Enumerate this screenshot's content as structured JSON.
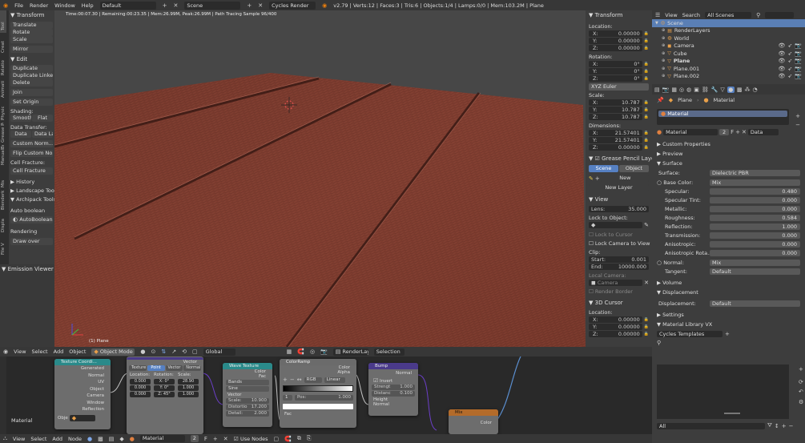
{
  "topbar": {
    "menu": [
      "File",
      "Render",
      "Window",
      "Help"
    ],
    "layout": "Default",
    "scene": "Scene",
    "engine": "Cycles Render",
    "stats": "v2.79 | Verts:12 | Faces:3 | Tris:6 | Objects:1/4 | Lamps:0/0 | Mem:103.2M | Plane"
  },
  "viewport": {
    "render_info": "Time:00:07.30 | Remaining:00:23.35 | Mem:26.99M, Peak:26.99M | Path Tracing Sample 96/400",
    "object_label": "(1) Plane",
    "colors": {
      "bg": "#474747",
      "wood": "#7a3a2c"
    }
  },
  "toolshelf": {
    "tabs": [
      "Tool",
      "Creat",
      "Relatio",
      "Animati",
      "Physic",
      "Grease Pen",
      "ManualBootstrapL",
      "Mis",
      "Blenderk",
      "Displa",
      "File V"
    ],
    "transform_header": "Transform",
    "translate": "Translate",
    "rotate": "Rotate",
    "scale": "Scale",
    "mirror": "Mirror",
    "edit_header": "Edit",
    "duplicate": "Duplicate",
    "duplicate_linked": "Duplicate Linked",
    "delete": "Delete",
    "join": "Join",
    "set_origin": "Set Origin",
    "shading_label": "Shading:",
    "smooth": "Smooth",
    "flat": "Flat",
    "data_transfer_label": "Data Transfer:",
    "data": "Data",
    "data_la": "Data La",
    "custom_norm": "Custom Norm...",
    "flip_custom": "Flip Custom No...",
    "cell_fracture_label": "Cell Fracture:",
    "cell_fracture": "Cell Fracture",
    "history": "History",
    "landscape": "Landscape Tool",
    "archipack": "Archipack Tools",
    "autoboolean_label": "Auto boolean",
    "autoboolean": "AutoBoolean",
    "rendering": "Rendering",
    "draw_over": "Draw over",
    "emission_viewer": "Emission Viewer"
  },
  "npanel": {
    "transform_header": "Transform",
    "location_label": "Location:",
    "location": [
      {
        "a": "X:",
        "v": "0.00000"
      },
      {
        "a": "Y:",
        "v": "0.00000"
      },
      {
        "a": "Z:",
        "v": "0.00000"
      }
    ],
    "rotation_label": "Rotation:",
    "rotation": [
      {
        "a": "X:",
        "v": "0°"
      },
      {
        "a": "Y:",
        "v": "0°"
      },
      {
        "a": "Z:",
        "v": "0°"
      }
    ],
    "euler": "XYZ Euler",
    "scale_label": "Scale:",
    "scale": [
      {
        "a": "X:",
        "v": "10.787"
      },
      {
        "a": "Y:",
        "v": "10.787"
      },
      {
        "a": "Z:",
        "v": "10.787"
      }
    ],
    "dimensions_label": "Dimensions:",
    "dimensions": [
      {
        "a": "X:",
        "v": "21.57401"
      },
      {
        "a": "Y:",
        "v": "21.57401"
      },
      {
        "a": "Z:",
        "v": "0.00000"
      }
    ],
    "grease_pencil": "Grease Pencil Laye",
    "scene_tab": "Scene",
    "object_tab": "Object",
    "new_btn": "New",
    "new_layer": "New Layer",
    "view_header": "View",
    "lens_label": "Lens:",
    "lens": "35.000",
    "lock_object": "Lock to Object:",
    "lock_cursor": "Lock to Cursor",
    "lock_camera": "Lock Camera to View",
    "clip_label": "Clip:",
    "clip_start_label": "Start:",
    "clip_start": "0.001",
    "clip_end_label": "End:",
    "clip_end": "10000.000",
    "local_camera": "Local Camera:",
    "camera": "Camera",
    "render_border": "Render Border",
    "cursor_header": "3D Cursor",
    "cursor_location": "Location:",
    "cursor": [
      {
        "a": "X:",
        "v": "0.00000"
      },
      {
        "a": "Y:",
        "v": "0.00000"
      },
      {
        "a": "Z:",
        "v": "0.00000"
      }
    ]
  },
  "outliner": {
    "view": "View",
    "search": "Search",
    "filter": "All Scenes",
    "items": [
      {
        "name": "Scene",
        "depth": 0,
        "icon": "scene-icon",
        "sel": true
      },
      {
        "name": "RenderLayers",
        "depth": 1,
        "icon": "render-layers-icon"
      },
      {
        "name": "World",
        "depth": 1,
        "icon": "world-icon"
      },
      {
        "name": "Camera",
        "depth": 1,
        "icon": "camera-icon",
        "vis": true
      },
      {
        "name": "Cube",
        "depth": 1,
        "icon": "mesh-icon",
        "vis": true
      },
      {
        "name": "Plane",
        "depth": 1,
        "icon": "mesh-icon",
        "vis": true,
        "bold": true
      },
      {
        "name": "Plane.001",
        "depth": 1,
        "icon": "mesh-icon",
        "vis": true
      },
      {
        "name": "Plane.002",
        "depth": 1,
        "icon": "mesh-icon",
        "vis": true
      }
    ]
  },
  "properties": {
    "breadcrumb_object": "Plane",
    "breadcrumb_material": "Material",
    "slot": "Material",
    "mat_name": "Material",
    "users": "2",
    "data": "Data",
    "sections": {
      "custom_props": "Custom Properties",
      "preview": "Preview",
      "surface": "Surface",
      "volume": "Volume",
      "displacement": "Displacement",
      "settings": "Settings",
      "matlib": "Material Library VX"
    },
    "surface_label": "Surface:",
    "surface_val": "Dielectric PBR",
    "base_color_label": "Base Color:",
    "base_color_val": "Mix",
    "rows": [
      {
        "l": "Specular:",
        "v": "0.480"
      },
      {
        "l": "Specular Tint:",
        "v": "0.000"
      },
      {
        "l": "Metallic:",
        "v": "0.000"
      },
      {
        "l": "Roughness:",
        "v": "0.584"
      },
      {
        "l": "Reflection:",
        "v": "1.000"
      },
      {
        "l": "Transmission:",
        "v": "0.000"
      },
      {
        "l": "Anisotropic:",
        "v": "0.000"
      },
      {
        "l": "Anisotropic Rota...",
        "v": "0.000"
      }
    ],
    "normal_label": "Normal:",
    "normal_val": "Mix",
    "tangent_label": "Tangent:",
    "tangent_val": "Default",
    "displacement_label": "Displacement:",
    "displacement_val": "Default",
    "templates": "Cycles Templates",
    "all": "All"
  },
  "view3d_header": {
    "menu": [
      "View",
      "Select",
      "Add",
      "Object"
    ],
    "mode": "Object Mode",
    "orientation": "Global",
    "renderlayer": "RenderLayer",
    "selection": "Selection"
  },
  "node_header": {
    "menu": [
      "View",
      "Select",
      "Add",
      "Node"
    ],
    "material": "Material",
    "users": "2",
    "use_nodes": "Use Nodes"
  },
  "nodes": {
    "tex_coord": {
      "title": "Texture Coordi...",
      "outputs": [
        "Generated",
        "Normal",
        "UV",
        "Object",
        "Camera",
        "Window",
        "Reflection"
      ],
      "obj_label": "Obje"
    },
    "mapping": {
      "title": "Mapping",
      "vector": "Vector",
      "tabs": [
        "Texture",
        "Point",
        "Vector",
        "Normal"
      ],
      "loc": "Location:",
      "rot": "Rotation:",
      "scl": "Scale:",
      "locv": [
        "0.000",
        "0.000",
        "0.000"
      ],
      "rotv": [
        "X: 0°",
        "Y: 0°",
        "Z: 45°"
      ],
      "sclv": [
        "28.90",
        "1.000",
        "1.000"
      ]
    },
    "wave": {
      "title": "Wave Texture",
      "color": "Color",
      "fac": "Fac",
      "bands": "Bands",
      "sine": "Sine",
      "vector": "Vector",
      "scale_l": "Scale:",
      "scale_v": "10.900",
      "distort_l": "Distortio",
      "distort_v": "17.200",
      "detail_l": "Detail:",
      "detail_v": "2.000"
    },
    "ramp": {
      "title": "ColorRamp",
      "color": "Color",
      "alpha": "Alpha",
      "rgb": "RGB",
      "linear": "Linear",
      "pos_l": "Pos:",
      "pos_v": "1.000",
      "one": "1",
      "fac": "Fac"
    },
    "bump": {
      "title": "Bump",
      "normal": "Normal",
      "invert": "Invert",
      "strength_l": "Strengt",
      "strength_v": "1.000",
      "distance_l": "Distanc",
      "distance_v": "0.100",
      "height": "Height",
      "normal_in": "Normal"
    },
    "mix": {
      "title": "Mix",
      "color": "Color"
    },
    "material_label": "Material"
  }
}
